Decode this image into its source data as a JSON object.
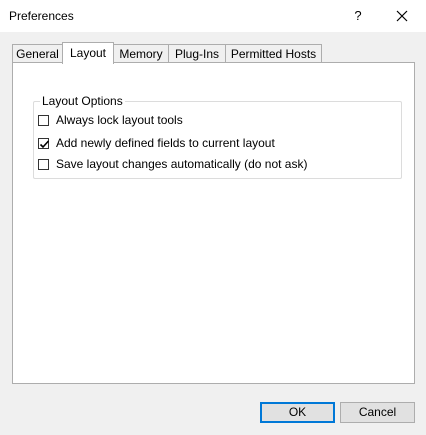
{
  "window": {
    "title": "Preferences",
    "help_label": "?"
  },
  "tabs": [
    {
      "label": "General",
      "active": false
    },
    {
      "label": "Layout",
      "active": true
    },
    {
      "label": "Memory",
      "active": false
    },
    {
      "label": "Plug-Ins",
      "active": false
    },
    {
      "label": "Permitted Hosts",
      "active": false
    }
  ],
  "layout_options": {
    "group_label": "Layout Options",
    "options": [
      {
        "label": "Always lock layout tools",
        "checked": false
      },
      {
        "label": "Add newly defined fields to current layout",
        "checked": true
      },
      {
        "label": "Save layout changes automatically (do not ask)",
        "checked": false
      }
    ]
  },
  "buttons": {
    "ok_label": "OK",
    "cancel_label": "Cancel"
  },
  "colors": {
    "accent": "#0078d7",
    "panel_border": "#adadad"
  },
  "icons": {
    "close": "close-icon",
    "checkmark": "checkmark-icon"
  }
}
